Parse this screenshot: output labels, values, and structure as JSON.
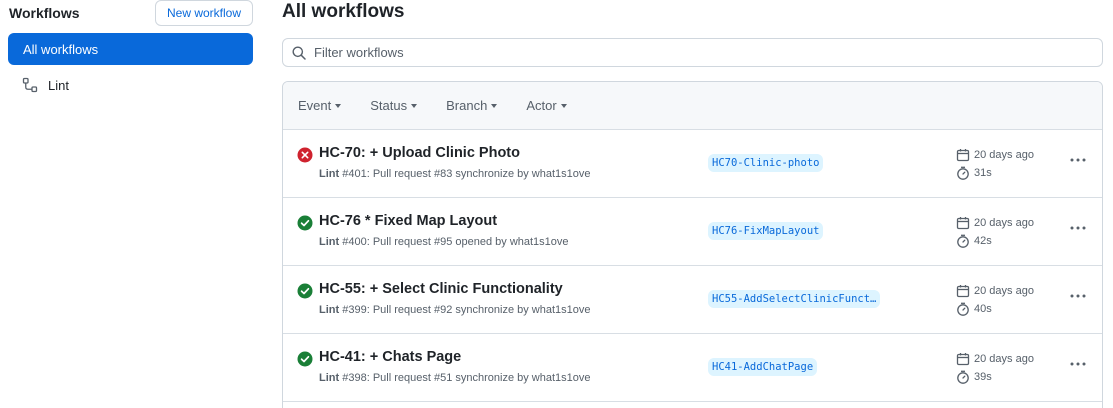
{
  "sidebar": {
    "title": "Workflows",
    "new_workflow_label": "New workflow",
    "items": [
      {
        "label": "All workflows",
        "active": true
      },
      {
        "label": "Lint",
        "icon": "workflow-icon"
      }
    ]
  },
  "main": {
    "title": "All workflows",
    "filter_placeholder": "Filter workflows",
    "filters": [
      "Event",
      "Status",
      "Branch",
      "Actor"
    ],
    "runs": [
      {
        "status": "failure",
        "title": "HC-70: + Upload Clinic Photo",
        "workflow": "Lint",
        "run": "#401",
        "meta": ": Pull request #83 synchronize by what1s1ove",
        "branch": "HC70-Clinic-photo",
        "when": "20 days ago",
        "duration": "31s"
      },
      {
        "status": "success",
        "title": "HC-76 * Fixed Map Layout",
        "workflow": "Lint",
        "run": "#400",
        "meta": ": Pull request #95 opened by what1s1ove",
        "branch": "HC76-FixMapLayout",
        "when": "20 days ago",
        "duration": "42s"
      },
      {
        "status": "success",
        "title": "HC-55: + Select Clinic Functionality",
        "workflow": "Lint",
        "run": "#399",
        "meta": ": Pull request #92 synchronize by what1s1ove",
        "branch": "HC55-AddSelectClinicFunct…",
        "when": "20 days ago",
        "duration": "40s"
      },
      {
        "status": "success",
        "title": "HC-41: + Chats Page",
        "workflow": "Lint",
        "run": "#398",
        "meta": ": Pull request #51 synchronize by what1s1ove",
        "branch": "HC41-AddChatPage",
        "when": "20 days ago",
        "duration": "39s"
      }
    ]
  },
  "colors": {
    "accent": "#0969da",
    "success": "#1a7f37",
    "failure": "#cf222e",
    "branch_bg": "#ddf4ff"
  }
}
